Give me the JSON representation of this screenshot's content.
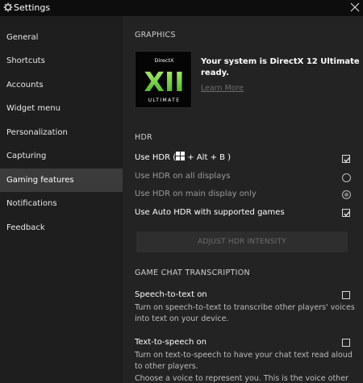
{
  "window": {
    "title": "Settings"
  },
  "sidebar": {
    "active_index": 6,
    "items": [
      {
        "label": "General"
      },
      {
        "label": "Shortcuts"
      },
      {
        "label": "Accounts"
      },
      {
        "label": "Widget menu"
      },
      {
        "label": "Personalization"
      },
      {
        "label": "Capturing"
      },
      {
        "label": "Gaming features"
      },
      {
        "label": "Notifications"
      },
      {
        "label": "Feedback"
      }
    ]
  },
  "graphics": {
    "header": "GRAPHICS",
    "logo_text_top": "DirectX",
    "logo_text_mid": "XII",
    "logo_text_bottom": "ULTIMATE",
    "status": "Your system is DirectX 12 Ultimate ready.",
    "learn_more": "Learn More"
  },
  "hdr": {
    "header": "HDR",
    "use_hdr_prefix": "Use HDR (",
    "use_hdr_suffix": " + Alt + B )",
    "use_hdr_checked": true,
    "all_displays_label": "Use HDR on all displays",
    "all_displays_selected": false,
    "main_display_label": "Use HDR on main display only",
    "main_display_selected": true,
    "auto_hdr_label": "Use Auto HDR with supported games",
    "auto_hdr_checked": true,
    "adjust_button": "ADJUST HDR INTENSITY"
  },
  "chat": {
    "header": "GAME CHAT TRANSCRIPTION",
    "stt_label": "Speech-to-text on",
    "stt_checked": false,
    "stt_desc": "Turn on speech-to-text to transcribe other players' voices into text on your device.",
    "tts_label": "Text-to-speech on",
    "tts_checked": false,
    "tts_desc": "Turn on text-to-speech to have your chat text read aloud to other players.",
    "tts_desc2": "Choose a voice to represent you. This is the voice other"
  },
  "colors": {
    "titlebar_bg": "#0d0d0d",
    "sidebar_bg": "#1e1e1e",
    "sidebar_active_bg": "#3b3b3b",
    "main_bg": "#232323",
    "dx_green": "#7cd93a"
  }
}
